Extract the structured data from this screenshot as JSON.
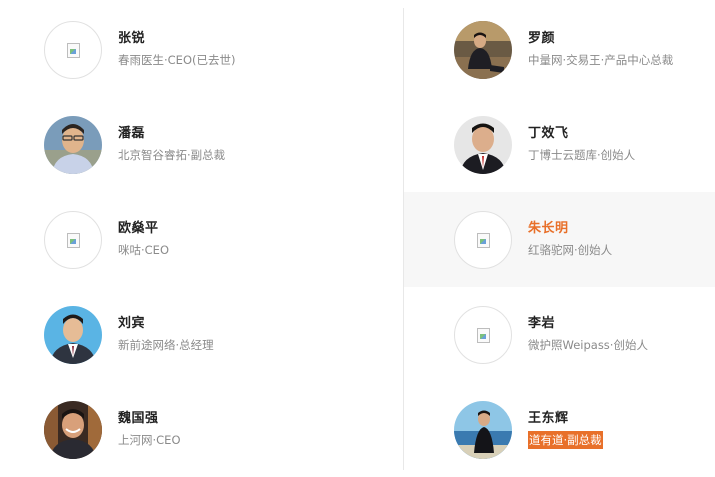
{
  "left": [
    {
      "name": "张锐",
      "title": "春雨医生·CEO(已去世)",
      "avatar": "broken"
    },
    {
      "name": "潘磊",
      "title": "北京智谷睿拓·副总裁",
      "avatar": "photo"
    },
    {
      "name": "欧燊平",
      "title": "咪咕·CEO",
      "avatar": "broken"
    },
    {
      "name": "刘宾",
      "title": "新前途网络·总经理",
      "avatar": "photo"
    },
    {
      "name": "魏国强",
      "title": "上河网·CEO",
      "avatar": "photo"
    }
  ],
  "right": [
    {
      "name": "罗颜",
      "title": "中量网·交易王·产品中心总裁",
      "avatar": "photo"
    },
    {
      "name": "丁效飞",
      "title": "丁博士云题库·创始人",
      "avatar": "photo"
    },
    {
      "name": "朱长明",
      "title": "红骆驼网·创始人",
      "avatar": "broken"
    },
    {
      "name": "李岩",
      "title": "微护照Weipass·创始人",
      "avatar": "broken"
    },
    {
      "name": "王东辉",
      "title": "道有道·副总裁",
      "avatar": "photo"
    }
  ],
  "colors": {
    "accent": "#e8702a",
    "hover_bg": "#f7f7f7"
  }
}
